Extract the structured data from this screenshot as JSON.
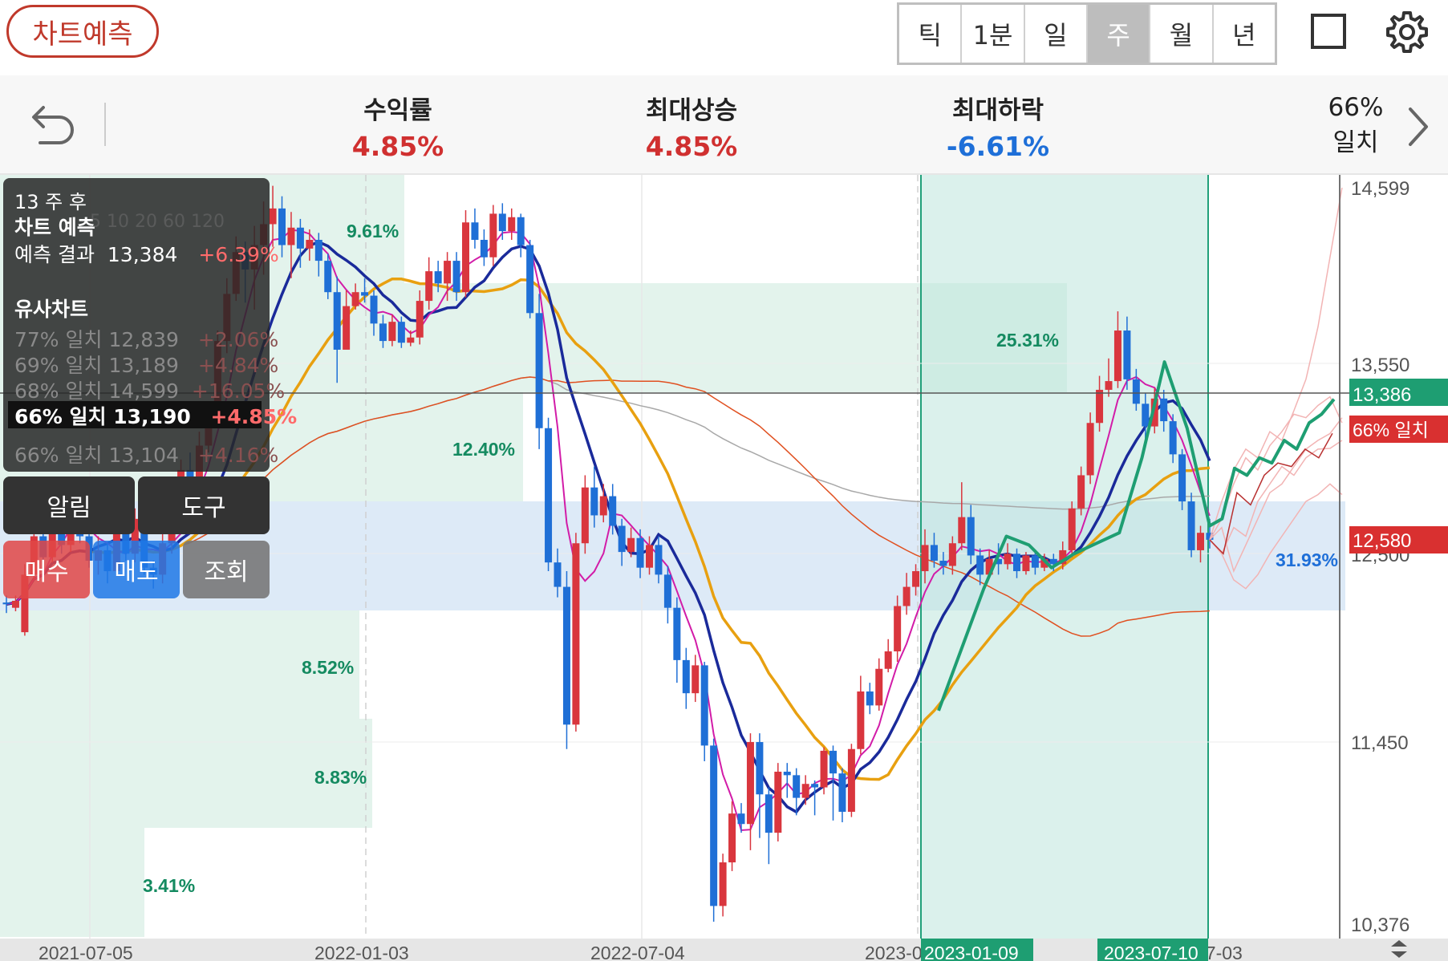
{
  "toolbar": {
    "predict_label": "차트예측",
    "periods": [
      "틱",
      "1분",
      "일",
      "주",
      "월",
      "년"
    ],
    "active_period": "주"
  },
  "stats": {
    "return": {
      "label": "수익률",
      "value": "4.85%",
      "color": "#d03030"
    },
    "max_rise": {
      "label": "최대상승",
      "value": "4.85%",
      "color": "#d03030"
    },
    "max_drop": {
      "label": "최대하락",
      "value": "-6.61%",
      "color": "#1e6fd8"
    },
    "match": {
      "percent": "66%",
      "label": "일치"
    }
  },
  "panel": {
    "weeks_after": "13 주 후",
    "predict_title": "차트 예측",
    "predict_result_label": "예측 결과",
    "predict_result_value": "13,384",
    "predict_result_change": "+6.39%",
    "similar_title": "유사차트",
    "similar": [
      {
        "match": "77% 일치",
        "price": "12,839",
        "change": "+2.06%",
        "selected": false
      },
      {
        "match": "69% 일치",
        "price": "13,189",
        "change": "+4.84%",
        "selected": false
      },
      {
        "match": "68% 일치",
        "price": "14,599",
        "change": "+16.05%",
        "selected": false
      },
      {
        "match": "66% 일치",
        "price": "13,190",
        "change": "+4.85%",
        "selected": true
      },
      {
        "match": "66% 일치",
        "price": "13,104",
        "change": "+4.16%",
        "selected": false
      }
    ],
    "ma_legend": [
      "5",
      "10",
      "20",
      "60",
      "120"
    ]
  },
  "buttons": {
    "alert": "알림",
    "tools": "도구",
    "buy": "매수",
    "sell": "매도",
    "query": "조회"
  },
  "price_axis": {
    "ticks": [
      "14,599",
      "13,550",
      "11,450",
      "10,376"
    ],
    "current_tag": "13,386",
    "match_tag": "66% 일치",
    "last_tag": "12,580",
    "hidden_tick": "12,500"
  },
  "date_axis": {
    "ticks": [
      "2021-07-05",
      "2022-01-03",
      "2022-07-04",
      "2023-0",
      "07-03"
    ],
    "range_start": "2023-01-09",
    "range_end": "2023-07-10"
  },
  "range_labels": [
    "9.61%",
    "12.40%",
    "25.31%",
    "8.52%",
    "8.83%",
    "3.41%",
    "31.93%"
  ],
  "colors": {
    "up": "#d9363e",
    "down": "#1f6fd6",
    "ma5": "#d21ca8",
    "ma10": "#1a2a9a",
    "ma20": "#e8a010",
    "ma60": "#e05020",
    "ma120": "#a8a8a8",
    "prediction": "#1e9e72"
  },
  "chart_data": {
    "type": "candlestick",
    "x": [
      "2021-07-05",
      "2022-01-03",
      "2022-07-04",
      "2023-01-09",
      "2023-07-10"
    ],
    "ylim": [
      10376,
      14599
    ],
    "current": 13386,
    "last": 12580,
    "candles": [
      [
        12220,
        12210,
        12260,
        12160
      ],
      [
        12190,
        12230,
        12260,
        12170
      ],
      [
        12050,
        12380,
        12440,
        12030
      ],
      [
        12380,
        12600,
        12700,
        12350
      ],
      [
        12600,
        12480,
        12720,
        12420
      ],
      [
        12480,
        12780,
        12850,
        12450
      ],
      [
        12780,
        12550,
        12880,
        12500
      ],
      [
        12550,
        12820,
        12880,
        12510
      ],
      [
        12820,
        12600,
        12910,
        12560
      ],
      [
        12600,
        12460,
        12650,
        12420
      ],
      [
        12460,
        12520,
        12600,
        12380
      ],
      [
        12520,
        12400,
        12560,
        12330
      ],
      [
        12400,
        12620,
        12700,
        12380
      ],
      [
        12620,
        12500,
        12690,
        12460
      ],
      [
        12500,
        12700,
        12760,
        12450
      ],
      [
        12700,
        12420,
        12760,
        12380
      ],
      [
        12420,
        12380,
        12460,
        12300
      ],
      [
        12380,
        12560,
        12620,
        12330
      ],
      [
        12560,
        12740,
        12800,
        12500
      ],
      [
        12740,
        12980,
        13040,
        12700
      ],
      [
        12980,
        12900,
        13080,
        12850
      ],
      [
        12900,
        13120,
        13200,
        12880
      ],
      [
        13120,
        13280,
        13350,
        13080
      ],
      [
        13280,
        13720,
        13780,
        13250
      ],
      [
        13720,
        13990,
        14080,
        13650
      ],
      [
        13990,
        14230,
        14320,
        13950
      ],
      [
        14230,
        14130,
        14290,
        13940
      ],
      [
        14130,
        14270,
        14380,
        13900
      ],
      [
        14270,
        14390,
        14520,
        14100
      ],
      [
        14390,
        14480,
        14610,
        14260
      ],
      [
        14480,
        14270,
        14550,
        14200
      ],
      [
        14270,
        14370,
        14460,
        14080
      ],
      [
        14370,
        14250,
        14420,
        14140
      ],
      [
        14250,
        14300,
        14360,
        14180
      ],
      [
        14300,
        14180,
        14340,
        14090
      ],
      [
        14180,
        14000,
        14220,
        13960
      ],
      [
        14000,
        13670,
        14090,
        13480
      ],
      [
        13670,
        13920,
        14010,
        13800
      ],
      [
        13920,
        14000,
        14050,
        13900
      ],
      [
        14000,
        13980,
        14080,
        13940
      ],
      [
        13980,
        13820,
        14010,
        13750
      ],
      [
        13820,
        13720,
        13870,
        13680
      ],
      [
        13720,
        13830,
        13870,
        13690
      ],
      [
        13830,
        13710,
        13860,
        13680
      ],
      [
        13710,
        13740,
        13780,
        13690
      ],
      [
        13740,
        13950,
        14010,
        13700
      ],
      [
        13950,
        14120,
        14200,
        13900
      ],
      [
        14120,
        14050,
        14180,
        14000
      ],
      [
        14050,
        14180,
        14230,
        13950
      ],
      [
        14180,
        14000,
        14230,
        13950
      ],
      [
        14000,
        14400,
        14470,
        13970
      ],
      [
        14400,
        14300,
        14480,
        14250
      ],
      [
        14300,
        14200,
        14360,
        14150
      ],
      [
        14200,
        14450,
        14500,
        14150
      ],
      [
        14450,
        14350,
        14510,
        14300
      ],
      [
        14350,
        14430,
        14480,
        14300
      ],
      [
        14430,
        14270,
        14450,
        14200
      ],
      [
        14270,
        13880,
        14300,
        13850
      ],
      [
        13880,
        13220,
        13990,
        13100
      ],
      [
        13220,
        12450,
        13280,
        12400
      ],
      [
        12450,
        12310,
        12530,
        12250
      ],
      [
        12310,
        11520,
        12400,
        11380
      ],
      [
        11520,
        12560,
        12620,
        11480
      ],
      [
        12560,
        12880,
        12950,
        12500
      ],
      [
        12880,
        12720,
        13000,
        12650
      ],
      [
        12720,
        12830,
        12900,
        12680
      ],
      [
        12830,
        12660,
        12900,
        12610
      ],
      [
        12660,
        12510,
        12700,
        12430
      ],
      [
        12510,
        12590,
        12650,
        12480
      ],
      [
        12590,
        12420,
        12640,
        12360
      ],
      [
        12420,
        12550,
        12600,
        12380
      ],
      [
        12550,
        12380,
        12600,
        12330
      ],
      [
        12380,
        12190,
        12430,
        12100
      ],
      [
        12190,
        11890,
        12250,
        11760
      ],
      [
        11890,
        11700,
        11960,
        11610
      ],
      [
        11700,
        11860,
        11920,
        11650
      ],
      [
        11860,
        11400,
        11880,
        11310
      ],
      [
        11400,
        10480,
        11440,
        10390
      ],
      [
        10480,
        10730,
        10780,
        10420
      ],
      [
        10730,
        11010,
        11080,
        10680
      ],
      [
        11010,
        10950,
        11070,
        10900
      ],
      [
        10950,
        11420,
        11470,
        10800
      ],
      [
        11420,
        11120,
        11470,
        10870
      ],
      [
        11120,
        10900,
        11160,
        10720
      ],
      [
        10900,
        11250,
        11300,
        10850
      ],
      [
        11250,
        11230,
        11300,
        11100
      ],
      [
        11230,
        11100,
        11270,
        11000
      ],
      [
        11100,
        11180,
        11230,
        11060
      ],
      [
        11180,
        11160,
        11200,
        11000
      ],
      [
        11160,
        11370,
        11390,
        11120
      ],
      [
        11370,
        11240,
        11400,
        10970
      ],
      [
        11240,
        11020,
        11270,
        10960
      ],
      [
        11020,
        11380,
        11410,
        10990
      ],
      [
        11380,
        11710,
        11800,
        11350
      ],
      [
        11710,
        11630,
        11760,
        11580
      ],
      [
        11630,
        11840,
        11900,
        11600
      ],
      [
        11840,
        11940,
        12010,
        11820
      ],
      [
        11940,
        12200,
        12260,
        11880
      ],
      [
        12200,
        12310,
        12390,
        12150
      ],
      [
        12310,
        12400,
        12440,
        12260
      ],
      [
        12400,
        12550,
        12640,
        12330
      ],
      [
        12550,
        12460,
        12620,
        12420
      ],
      [
        12460,
        12430,
        12510,
        12380
      ],
      [
        12430,
        12560,
        12600,
        12380
      ],
      [
        12560,
        12710,
        12910,
        12520
      ],
      [
        12710,
        12490,
        12780,
        12440
      ],
      [
        12490,
        12380,
        12530,
        12320
      ],
      [
        12380,
        12470,
        12520,
        12360
      ],
      [
        12470,
        12440,
        12560,
        12380
      ],
      [
        12440,
        12500,
        12560,
        12410
      ],
      [
        12500,
        12400,
        12530,
        12360
      ],
      [
        12400,
        12490,
        12510,
        12380
      ],
      [
        12490,
        12420,
        12520,
        12380
      ],
      [
        12420,
        12470,
        12500,
        12400
      ],
      [
        12470,
        12440,
        12500,
        12400
      ],
      [
        12440,
        12520,
        12570,
        12410
      ],
      [
        12520,
        12760,
        12800,
        12480
      ],
      [
        12760,
        12950,
        13000,
        12720
      ],
      [
        12950,
        13250,
        13310,
        12900
      ],
      [
        13250,
        13440,
        13520,
        13200
      ],
      [
        13440,
        13490,
        13620,
        13400
      ],
      [
        13490,
        13780,
        13890,
        13450
      ],
      [
        13780,
        13500,
        13860,
        13440
      ],
      [
        13500,
        13360,
        13560,
        13320
      ],
      [
        13360,
        13230,
        13420,
        13110
      ],
      [
        13230,
        13390,
        13450,
        13190
      ],
      [
        13390,
        13260,
        13440,
        13200
      ],
      [
        13260,
        13070,
        13300,
        13020
      ],
      [
        13070,
        12800,
        13100,
        12750
      ],
      [
        12800,
        12520,
        12850,
        12480
      ],
      [
        12520,
        12620,
        12660,
        12450
      ],
      [
        12620,
        12580,
        12700,
        12530
      ]
    ]
  }
}
